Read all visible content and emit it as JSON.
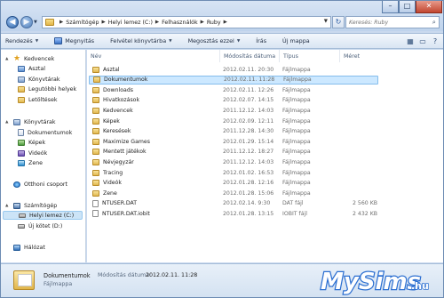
{
  "window": {
    "buttons": {
      "minimize": "–",
      "maximize": "□",
      "close": "✕"
    }
  },
  "address": {
    "breadcrumbs": [
      "Számítógép",
      "Helyi lemez (C:)",
      "Felhasználók",
      "Ruby"
    ]
  },
  "search": {
    "placeholder": "Keresés: Ruby"
  },
  "toolbar": {
    "organize": "Rendezés",
    "share": "Megnyitás",
    "include": "Felvétel könyvtárba",
    "share_with": "Megosztás ezzel",
    "burn": "Írás",
    "new_folder": "Új mappa"
  },
  "nav": {
    "favorites": "Kedvencek",
    "desktop": "Asztal",
    "downloads": "Könyvtárak",
    "recent": "Legutóbbi helyek",
    "dl": "Letöltések",
    "libraries": "Könyvtárak",
    "documents": "Dokumentumok",
    "pictures": "Képek",
    "videos": "Videók",
    "music": "Zene",
    "homegroup": "Otthoni csoport",
    "computer": "Számítógép",
    "local_disk": "Helyi lemez (C:)",
    "new_volume": "Új kötet (D:)",
    "network": "Hálózat"
  },
  "columns": {
    "name": "Név",
    "date": "Módosítás dátuma",
    "type": "Típus",
    "size": "Méret"
  },
  "files": [
    {
      "name": "Asztal",
      "date": "2012.02.11. 20:30",
      "type": "Fájlmappa",
      "size": "",
      "kind": "folder"
    },
    {
      "name": "Dokumentumok",
      "date": "2012.02.11. 11:28",
      "type": "Fájlmappa",
      "size": "",
      "kind": "folder"
    },
    {
      "name": "Downloads",
      "date": "2012.02.11. 12:26",
      "type": "Fájlmappa",
      "size": "",
      "kind": "folder"
    },
    {
      "name": "Hivatkozások",
      "date": "2012.02.07. 14:15",
      "type": "Fájlmappa",
      "size": "",
      "kind": "folder"
    },
    {
      "name": "Kedvencek",
      "date": "2011.12.12. 14:03",
      "type": "Fájlmappa",
      "size": "",
      "kind": "folder"
    },
    {
      "name": "Képek",
      "date": "2012.02.09. 12:11",
      "type": "Fájlmappa",
      "size": "",
      "kind": "folder"
    },
    {
      "name": "Keresések",
      "date": "2011.12.28. 14:30",
      "type": "Fájlmappa",
      "size": "",
      "kind": "folder"
    },
    {
      "name": "Maximize Games",
      "date": "2012.01.29. 15:14",
      "type": "Fájlmappa",
      "size": "",
      "kind": "folder"
    },
    {
      "name": "Mentett játékok",
      "date": "2011.12.12. 18:27",
      "type": "Fájlmappa",
      "size": "",
      "kind": "folder"
    },
    {
      "name": "Névjegyzár",
      "date": "2011.12.12. 14:03",
      "type": "Fájlmappa",
      "size": "",
      "kind": "folder"
    },
    {
      "name": "Tracing",
      "date": "2012.01.02. 16:53",
      "type": "Fájlmappa",
      "size": "",
      "kind": "folder"
    },
    {
      "name": "Videók",
      "date": "2012.01.28. 12:16",
      "type": "Fájlmappa",
      "size": "",
      "kind": "folder"
    },
    {
      "name": "Zene",
      "date": "2012.01.28. 15:06",
      "type": "Fájlmappa",
      "size": "",
      "kind": "folder"
    },
    {
      "name": "NTUSER.DAT",
      "date": "2012.02.14. 9:30",
      "type": "DAT fájl",
      "size": "2 560 KB",
      "kind": "file"
    },
    {
      "name": "NTUSER.DAT.iobit",
      "date": "2012.01.28. 13:15",
      "type": "IOBIT fájl",
      "size": "2 432 KB",
      "kind": "file"
    }
  ],
  "details": {
    "name": "Dokumentumok",
    "modified_label": "Módosítás dátuma:",
    "modified_value": "2012.02.11. 11:28",
    "type": "Fájlmappa"
  },
  "watermark": {
    "text": "MySims.hu"
  },
  "colors": {
    "selection": "#cce8ff",
    "selection_border": "#84bdec",
    "frame": "#c9d9ee"
  }
}
